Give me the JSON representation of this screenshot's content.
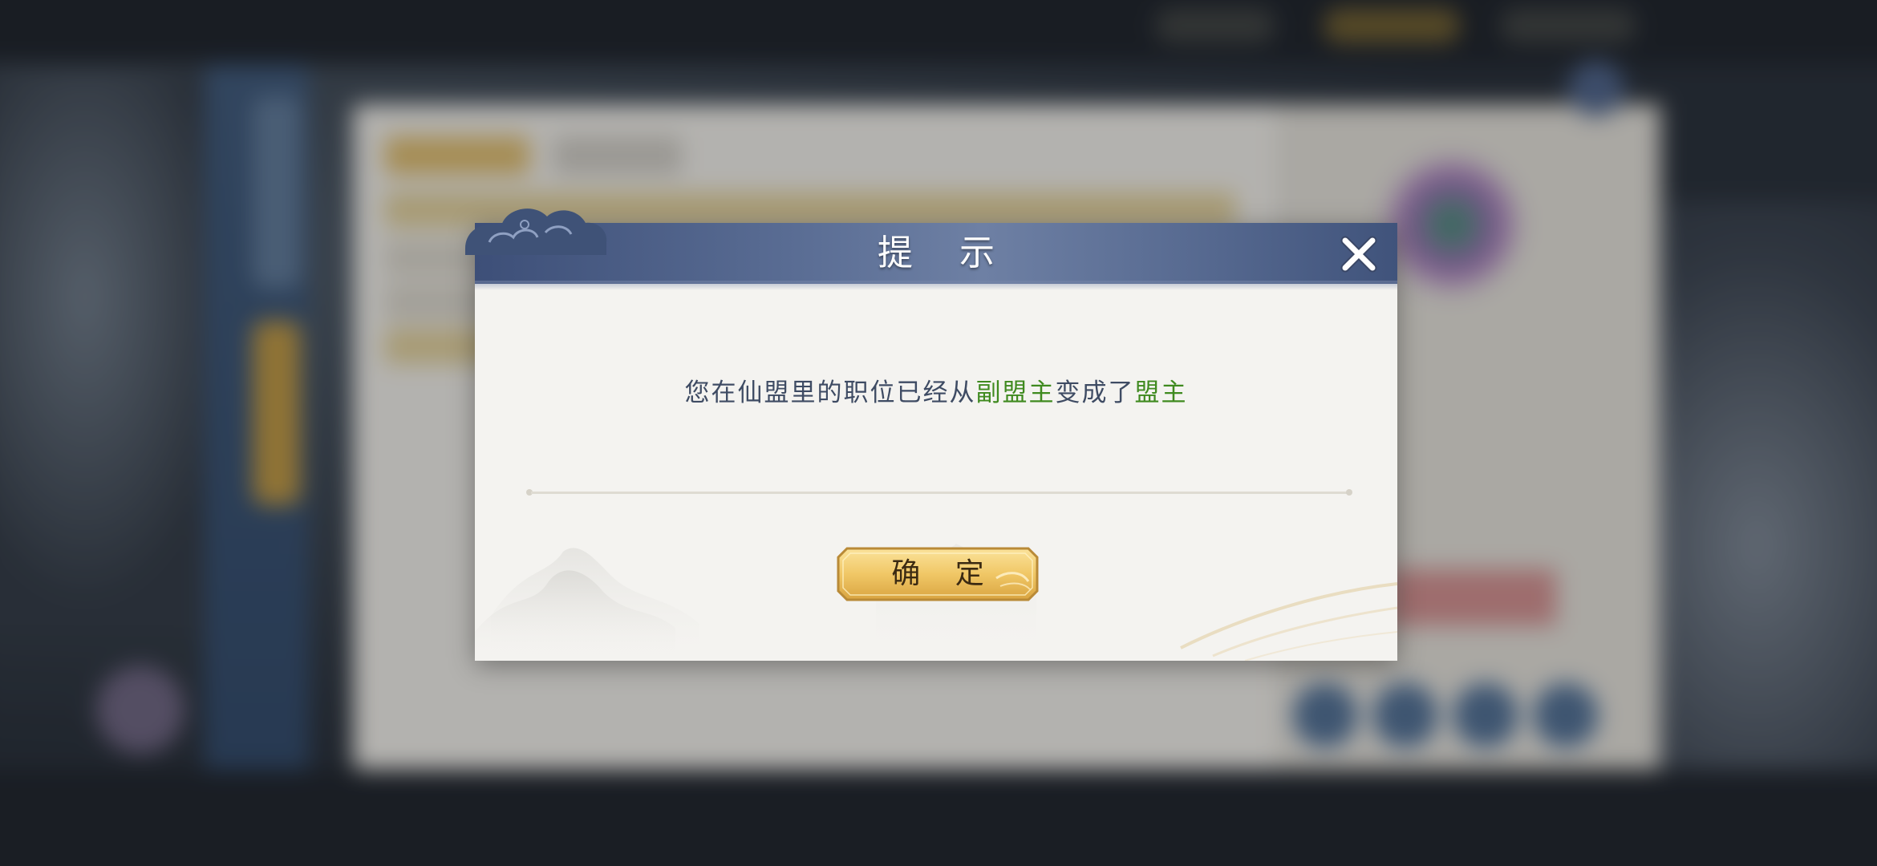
{
  "dialog": {
    "title": "提 示",
    "message": {
      "prefix": "您在仙盟里的职位已经从",
      "old_role": "副盟主",
      "middle": "变成了",
      "new_role": "盟主"
    },
    "confirm_label": "确 定",
    "close_icon": "close-x-icon"
  },
  "colors": {
    "header": "#55688f",
    "highlight_green": "#3f8a1f",
    "message_text": "#3e4b63",
    "button_gold": "#f0c766"
  }
}
